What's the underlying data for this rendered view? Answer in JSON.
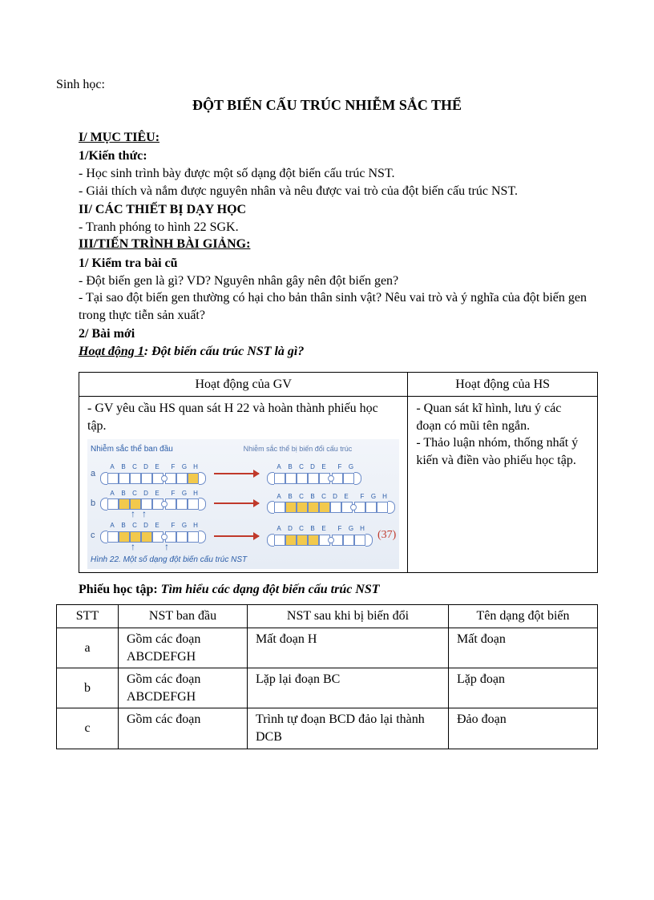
{
  "subject": "Sinh học:",
  "title": "ĐỘT BIẾN CẤU TRÚC NHIỄM SẮC THỂ",
  "sections": {
    "s1_h": "I/ MỤC TIÊU:",
    "s1_sub1": "1/Kiến thức:",
    "s1_p1": "- Học sinh trình bày được một số dạng đột biến cấu trúc NST.",
    "s1_p2": "- Giải thích và nắm được nguyên nhân và nêu được vai trò của đột biến cấu trúc NST.",
    "s2_h": "II/ CÁC THIẾT BỊ DẠY HỌC",
    "s2_p1": "- Tranh phóng to hình 22 SGK.",
    "s3_h": "III/TIẾN TRÌNH BÀI GIẢNG:",
    "s3_sub1": "1/ Kiểm tra bài cũ",
    "s3_p1": "- Đột biến gen là gì? VD? Nguyên nhân gây nên đột biến gen?",
    "s3_p2": "- Tại sao đột biến gen thường có hại cho bản thân sinh vật? Nêu vai trò và ý nghĩa của đột biến gen trong thực tiễn sản xuất?",
    "s3_sub2": "2/ Bài mới",
    "activity_label": "Hoạt động 1",
    "activity_desc": ": Đột biến cấu trúc NST là gì?"
  },
  "gvhs": {
    "gv_header": "Hoạt động của GV",
    "hs_header": "Hoạt động của HS",
    "gv_p1": "- GV yêu cầu HS quan sát H 22 và hoàn thành phiếu học tập.",
    "hs_p1": "- Quan sát kĩ hình, lưu ý  các đoạn có mũi tên ngắn.",
    "hs_p2": "- Thảo luận nhóm, thống nhất ý kiến và điền vào phiếu học tập."
  },
  "diagram": {
    "caption_top": "Nhiễm sắc thể ban đầu",
    "caption_sub": "Nhiễm sắc thể bị biến đổi cấu trúc",
    "row_a": "a",
    "row_b": "b",
    "row_c": "c",
    "labels_left": [
      "A",
      "B",
      "C",
      "D",
      "E",
      "F",
      "G",
      "H"
    ],
    "labels_a_right": [
      "A",
      "B",
      "C",
      "D",
      "E",
      "F",
      "G"
    ],
    "labels_b_right": [
      "A",
      "B",
      "C",
      "B",
      "C",
      "D",
      "E",
      "F",
      "G",
      "H"
    ],
    "labels_c_right": [
      "A",
      "D",
      "C",
      "B",
      "E",
      "F",
      "G",
      "H"
    ],
    "annot": "(37)",
    "fig_caption": "Hình 22. Một số dạng đột biến cấu trúc NST"
  },
  "worksheet": {
    "lead": "Phiếu học tập: ",
    "body": "Tìm hiểu các dạng đột biến cấu trúc NST"
  },
  "table": {
    "headers": [
      "STT",
      "NST ban đầu",
      "NST sau khi bị biến đổi",
      "Tên dạng đột biến"
    ],
    "rows": [
      {
        "stt": "a",
        "orig": "Gồm các đoạn ABCDEFGH",
        "after": "Mất đoạn H",
        "name": "Mất đoạn"
      },
      {
        "stt": "b",
        "orig": "Gồm các đoạn ABCDEFGH",
        "after": "Lặp lại đoạn BC",
        "name": "Lặp đoạn"
      },
      {
        "stt": "c",
        "orig": "Gồm các đoạn",
        "after": "Trình tự đoạn BCD đảo lại thành DCB",
        "name": "Đảo đoạn"
      }
    ]
  }
}
